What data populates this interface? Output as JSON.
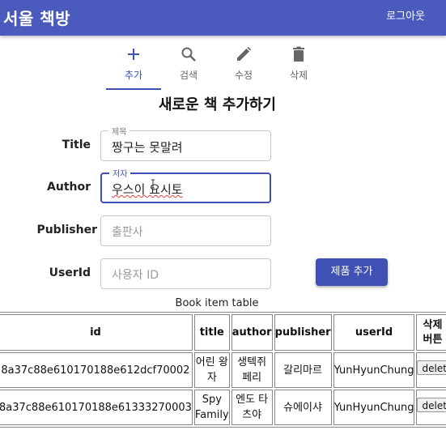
{
  "appbar": {
    "title": "서울 책방",
    "logout_label": "로그아웃"
  },
  "tabs": [
    {
      "label": "추가",
      "icon": "plus-icon",
      "active": true
    },
    {
      "label": "검색",
      "icon": "search-icon",
      "active": false
    },
    {
      "label": "수정",
      "icon": "pencil-icon",
      "active": false
    },
    {
      "label": "삭제",
      "icon": "trash-icon",
      "active": false
    }
  ],
  "form": {
    "heading": "새로운 책 추가하기",
    "title": {
      "label": "Title",
      "legend": "제목",
      "value": "짱구는 못말려"
    },
    "author": {
      "label": "Author",
      "legend": "저자",
      "value": "우스이 요시토"
    },
    "publisher": {
      "label": "Publisher",
      "placeholder": "출판사"
    },
    "userid": {
      "label": "UserId",
      "placeholder": "사용자 ID"
    },
    "submit_label": "제품 추가"
  },
  "table": {
    "caption": "Book item table",
    "headers": [
      "id",
      "title",
      "author",
      "publisher",
      "userId",
      "삭제 버튼"
    ],
    "rows": [
      {
        "id": "8a37c88e610170188e612dcf70002",
        "title": "어린 왕자",
        "author": "생텍쥐 페리",
        "publisher": "갈리마르",
        "userId": "YunHyunChung",
        "delete": "delete"
      },
      {
        "id": "8a37c88e610170188e61333270003",
        "title": "Spy Family",
        "author": "엔도 타츠야",
        "publisher": "슈에이샤",
        "userId": "YunHyunChung",
        "delete": "delete"
      }
    ]
  },
  "colors": {
    "primary": "#3f51b5",
    "appbar": "#4a5bbd"
  }
}
